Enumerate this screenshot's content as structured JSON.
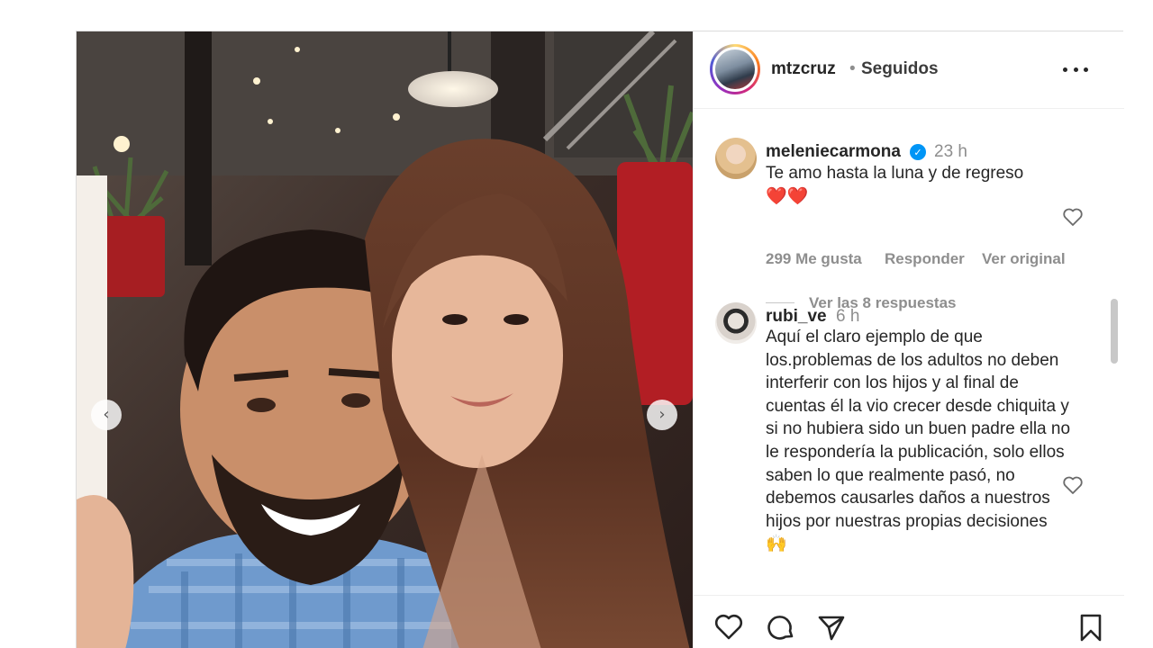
{
  "post": {
    "author": "mtzcruz",
    "separator": "•",
    "follow_status": "Seguidos"
  },
  "icons": {
    "more": "more-options-icon",
    "like": "heart-icon",
    "comment": "comment-bubble-icon",
    "share": "paper-plane-icon",
    "save": "bookmark-icon",
    "prev": "chevron-left-icon",
    "next": "chevron-right-icon",
    "verified": "verified-badge-icon"
  },
  "colors": {
    "verified_blue": "#0095f6",
    "secondary_text": "#8e8e8e",
    "primary_text": "#262626",
    "heart_red": "#e0242e"
  },
  "comments": [
    {
      "username": "meleniecarmona",
      "verified": true,
      "time": "23 h",
      "text": "Te amo hasta la luna y de regreso",
      "emoji": "❤️❤️",
      "likes": "299 Me gusta",
      "reply_label": "Responder",
      "translate_label": "Ver original",
      "view_replies": "Ver las 8 respuestas"
    },
    {
      "username": "rubi_ve",
      "verified": false,
      "time": "6 h",
      "text": "Aquí el claro ejemplo de que los.problemas de los adultos no deben interferir con los hijos y al final de cuentas él la vio crecer desde chiquita y si no hubiera sido un buen padre ella no le respondería la publicación, solo ellos saben lo que realmente pasó, no debemos causarles daños a nuestros hijos por nuestras propias decisiones 🙌"
    }
  ]
}
